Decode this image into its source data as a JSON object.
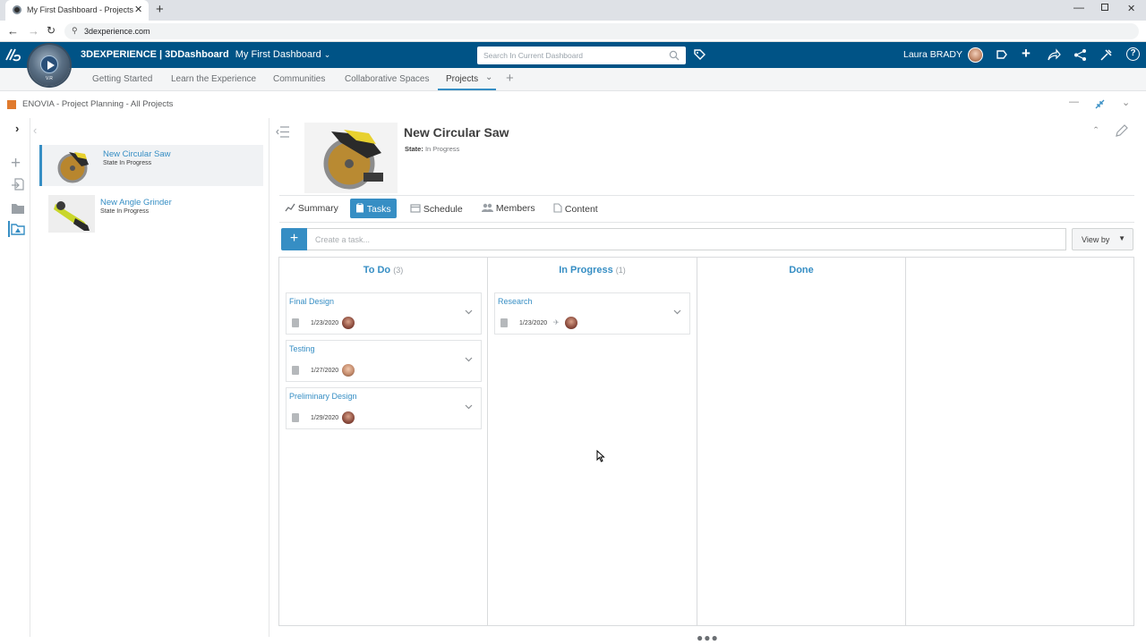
{
  "browser": {
    "tab_title": "My First Dashboard - Projects",
    "url": "3dexperience.com"
  },
  "topbar": {
    "brand_bold": "3D",
    "brand_rest": "EXPERIENCE | 3DDashboard",
    "dashboard_name": "My First Dashboard",
    "search_placeholder": "Search In Current Dashboard",
    "user_name": "Laura BRADY",
    "compass_label": "V.R"
  },
  "dashboard_tabs": [
    "Getting Started",
    "Learn the Experience",
    "Communities",
    "Collaborative Spaces",
    "Projects"
  ],
  "widget": {
    "title": "ENOVIA - Project Planning - All Projects"
  },
  "projects": [
    {
      "name": "New Circular Saw",
      "state": "State In Progress"
    },
    {
      "name": "New Angle Grinder",
      "state": "State In Progress"
    }
  ],
  "detail": {
    "title": "New Circular Saw",
    "state_label": "State:",
    "state_value": "In Progress",
    "tabs": [
      "Summary",
      "Tasks",
      "Schedule",
      "Members",
      "Content"
    ],
    "active_tab": "Tasks",
    "create_placeholder": "Create a task...",
    "view_by": "View by"
  },
  "board": {
    "columns": [
      {
        "title": "To Do",
        "count": "(3)",
        "cards": [
          {
            "title": "Final Design",
            "date": "1/23/2020"
          },
          {
            "title": "Testing",
            "date": "1/27/2020"
          },
          {
            "title": "Preliminary Design",
            "date": "1/29/2020"
          }
        ]
      },
      {
        "title": "In Progress",
        "count": "(1)",
        "cards": [
          {
            "title": "Research",
            "date": "1/23/2020"
          }
        ]
      },
      {
        "title": "Done",
        "count": "",
        "cards": []
      },
      {
        "title": "",
        "count": "",
        "cards": []
      }
    ]
  },
  "colors": {
    "topbar": "#005386",
    "accent": "#368ec4"
  }
}
